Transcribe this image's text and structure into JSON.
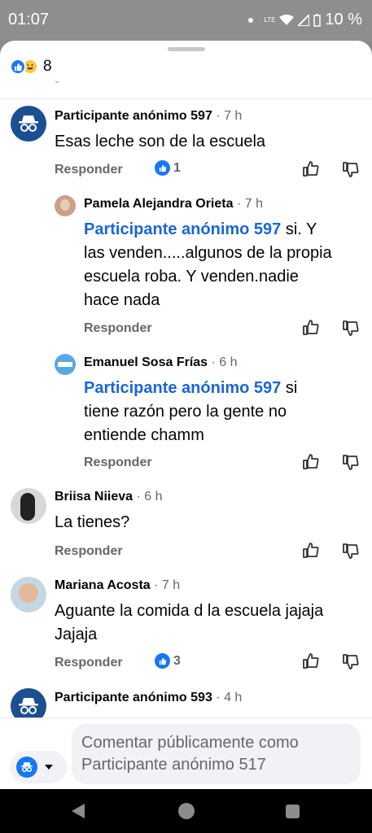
{
  "status_bar": {
    "time": "01:07",
    "network": "LTE",
    "battery": "10 %"
  },
  "reactions_summary": {
    "count": "8"
  },
  "comments": [
    {
      "author": "Participante anónimo 597",
      "time": " · 7 h",
      "mention": "",
      "text": "Esas leche son de la escuela",
      "reply": "Responder",
      "reaction_count": "1"
    },
    {
      "author": "Pamela Alejandra Orieta",
      "time": " · 7 h",
      "mention": "Participante anónimo 597",
      "text": " si. Y las venden.....algunos de la propia escuela roba. Y venden.nadie hace nada",
      "reply": "Responder",
      "reaction_count": ""
    },
    {
      "author": "Emanuel Sosa Frías",
      "time": " · 6 h",
      "mention": "Participante anónimo 597",
      "text": " si tiene razón pero la gente no entiende chamm",
      "reply": "Responder",
      "reaction_count": ""
    },
    {
      "author": "Briisa Niieva",
      "time": " · 6 h",
      "mention": "",
      "text": "La tienes?",
      "reply": "Responder",
      "reaction_count": ""
    },
    {
      "author": "Mariana Acosta",
      "time": " · 7 h",
      "mention": "",
      "text": "Aguante la comida d la escuela jajaja Jajaja",
      "reply": "Responder",
      "reaction_count": "3"
    },
    {
      "author": "Participante anónimo 593",
      "time": " · 4 h",
      "mention": "",
      "text": "",
      "reply": "",
      "reaction_count": ""
    }
  ],
  "composer": {
    "placeholder": "Comentar públicamente como Participante anónimo 517"
  },
  "colors": {
    "accent": "#1877f2",
    "mention": "#1867d6",
    "anon_avatar": "#1c4f8f"
  }
}
